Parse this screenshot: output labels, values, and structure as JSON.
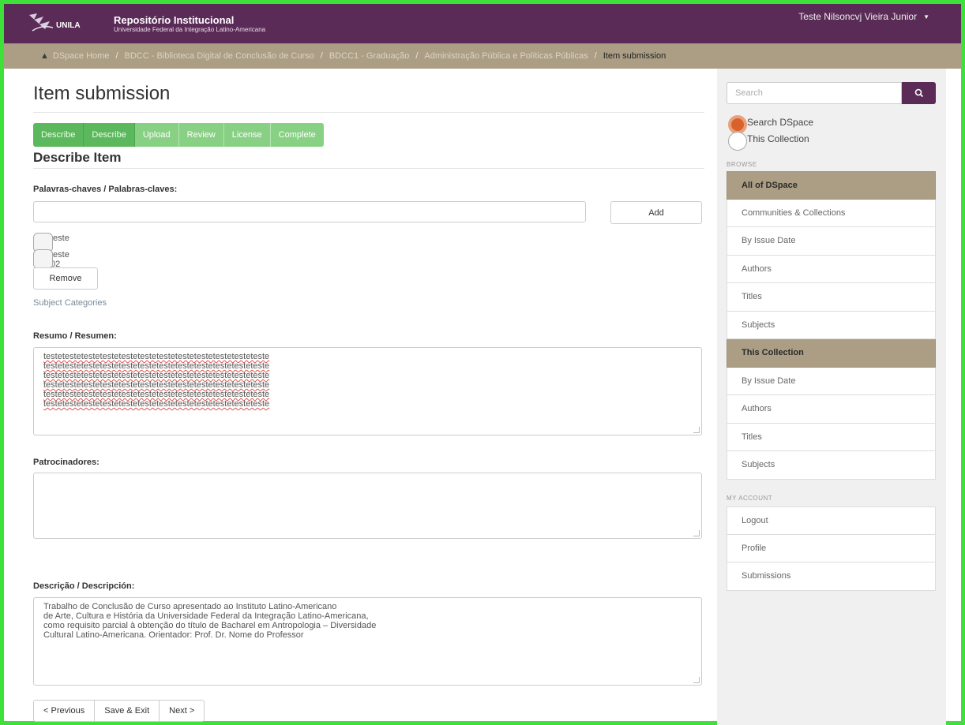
{
  "header": {
    "logo_text": "UNILA",
    "title": "Repositório Institucional",
    "subtitle": "Universidade Federal da Integração Latino-Americana",
    "user_name": "Teste Nilsoncvj Vieira Junior"
  },
  "breadcrumb": {
    "items": [
      "DSpace Home",
      "BDCC - Biblioteca Digital de Conclusão de Curso",
      "BDCC1 - Graduação",
      "Administração Pública e Políticas Públicas"
    ],
    "current": "Item submission"
  },
  "main": {
    "title": "Item submission",
    "steps": [
      {
        "label": "Describe",
        "state": "done"
      },
      {
        "label": "Describe",
        "state": "done"
      },
      {
        "label": "Upload",
        "state": "pending"
      },
      {
        "label": "Review",
        "state": "pending"
      },
      {
        "label": "License",
        "state": "pending"
      },
      {
        "label": "Complete",
        "state": "pending"
      }
    ],
    "section_title": "Describe Item",
    "keywords": {
      "label": "Palavras-chaves / Palabras-claves:",
      "add_label": "Add",
      "items": [
        "teste",
        "teste 02"
      ],
      "remove_label": "Remove",
      "subject_link": "Subject Categories"
    },
    "abstract": {
      "label": "Resumo / Resumen:",
      "lines": [
        "testetestetestetestetestetestetestetestetestetestetesteteste",
        "testetestetestetestetestetestetestetestetestetestetesteteste",
        "testetestetestetestetestetestetestetestetestetestetesteteste",
        "testetestetestetestetestetestetestetestetestetestetesteteste",
        "testetestetestetestetestetestetestetestetestetestetesteteste",
        "testetestetestetestetestetestetestetestetestetestetesteteste"
      ]
    },
    "sponsors": {
      "label": "Patrocinadores:"
    },
    "description": {
      "label": "Descrição / Descripción:",
      "lines": [
        "Trabalho de Conclusão de Curso apresentado ao Instituto Latino-Americano",
        "de Arte, Cultura e História da Universidade Federal da Integração Latino-Americana,",
        "como requisito parcial à obtenção do título de Bacharel em Antropologia – Diversidade",
        "Cultural Latino-Americana. Orientador: Prof. Dr. Nome do Professor"
      ]
    },
    "nav": {
      "previous": "< Previous",
      "save_exit": "Save & Exit",
      "next": "Next >"
    }
  },
  "sidebar": {
    "search_placeholder": "Search",
    "scope_options": [
      {
        "label": "Search DSpace",
        "checked": true
      },
      {
        "label": "This Collection",
        "checked": false
      }
    ],
    "browse_caption": "BROWSE",
    "browse_groups": [
      {
        "header": "All of DSpace",
        "items": [
          "Communities & Collections",
          "By Issue Date",
          "Authors",
          "Titles",
          "Subjects"
        ]
      },
      {
        "header": "This Collection",
        "items": [
          "By Issue Date",
          "Authors",
          "Titles",
          "Subjects"
        ]
      }
    ],
    "account_caption": "MY ACCOUNT",
    "account_items": [
      "Logout",
      "Profile",
      "Submissions"
    ]
  },
  "colors": {
    "header_bg": "#5b2b57",
    "breadcrumb_bg": "#ab9e85",
    "step_done": "#5cb85c",
    "step_pending": "#88d084",
    "frame": "#3ee03a"
  }
}
